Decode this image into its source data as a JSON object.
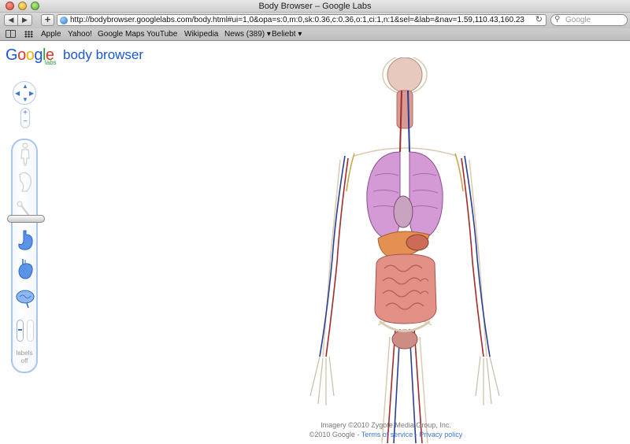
{
  "window": {
    "title": "Body Browser – Google Labs"
  },
  "toolbar": {
    "back": "◀",
    "forward": "▶",
    "add": "+",
    "url": "http://bodybrowser.googlelabs.com/body.html#ui=1,0&opa=s:0,m:0,sk:0.36,c:0.36,o:1,ci:1,n:1&sel=&lab=&nav=1.59,110.43,160.23",
    "reload": "↻",
    "search_placeholder": "Google",
    "search_glyph": "⚲"
  },
  "bookmarks": [
    {
      "label": "Apple"
    },
    {
      "label": "Yahoo!"
    },
    {
      "label": "Google Maps"
    },
    {
      "label": "YouTube"
    },
    {
      "label": "Wikipedia"
    },
    {
      "label": "News (389) ▾"
    },
    {
      "label": "Beliebt ▾"
    }
  ],
  "app": {
    "logo": {
      "G": "G",
      "o1": "o",
      "o2": "o",
      "g": "g",
      "l": "l",
      "e": "e",
      "sub": "labs"
    },
    "name": "body browser"
  },
  "controls": {
    "pan": {
      "up": "▲",
      "down": "▼",
      "left": "◀",
      "right": "▶"
    },
    "zoom": {
      "in": "+",
      "out": "−"
    },
    "labels": {
      "line1": "labels",
      "line2": "off"
    }
  },
  "colors": {
    "accent": "#3d77d6",
    "panel_border": "#a9c6ee",
    "layer_active": "#5b93e6"
  },
  "footer": {
    "imagery": "Imagery ©2010 Zygote Media Group, Inc.",
    "copyright": "©2010 Google -",
    "terms": "Terms of service",
    "separator": " - ",
    "privacy": "Privacy policy"
  }
}
